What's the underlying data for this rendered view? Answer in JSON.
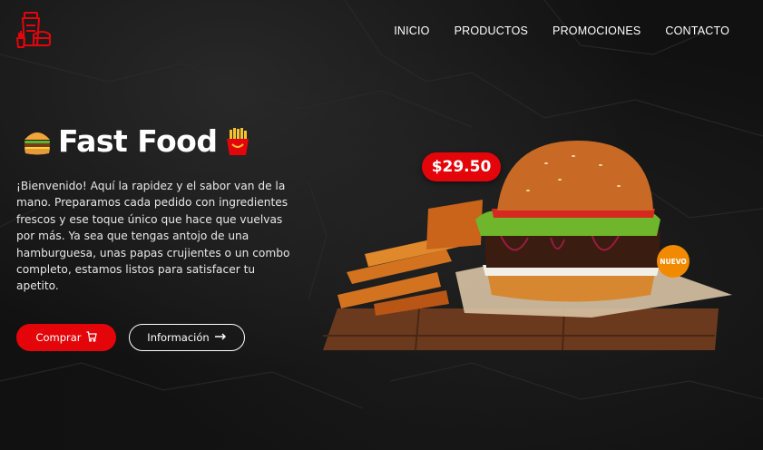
{
  "nav": {
    "items": [
      "INICIO",
      "PRODUCTOS",
      "PROMOCIONES",
      "CONTACTO"
    ]
  },
  "hero": {
    "title": "Fast Food",
    "left_icon": "hamburger-icon",
    "right_icon": "fries-icon",
    "description": "¡Bienvenido! Aquí la rapidez y el sabor van de la mano. Preparamos cada pedido con ingredientes frescos y ese toque único que hace que vuelvas por más. Ya sea que tengas antojo de una hamburguesa, unas papas crujientes o un combo completo, estamos listos para satisfacer tu apetito.",
    "buy_label": "Comprar",
    "info_label": "Información"
  },
  "product": {
    "price": "$29.50",
    "badge": "NUEVO"
  },
  "colors": {
    "accent": "#e3050a",
    "badge": "#f28a00",
    "background": "#111111"
  }
}
